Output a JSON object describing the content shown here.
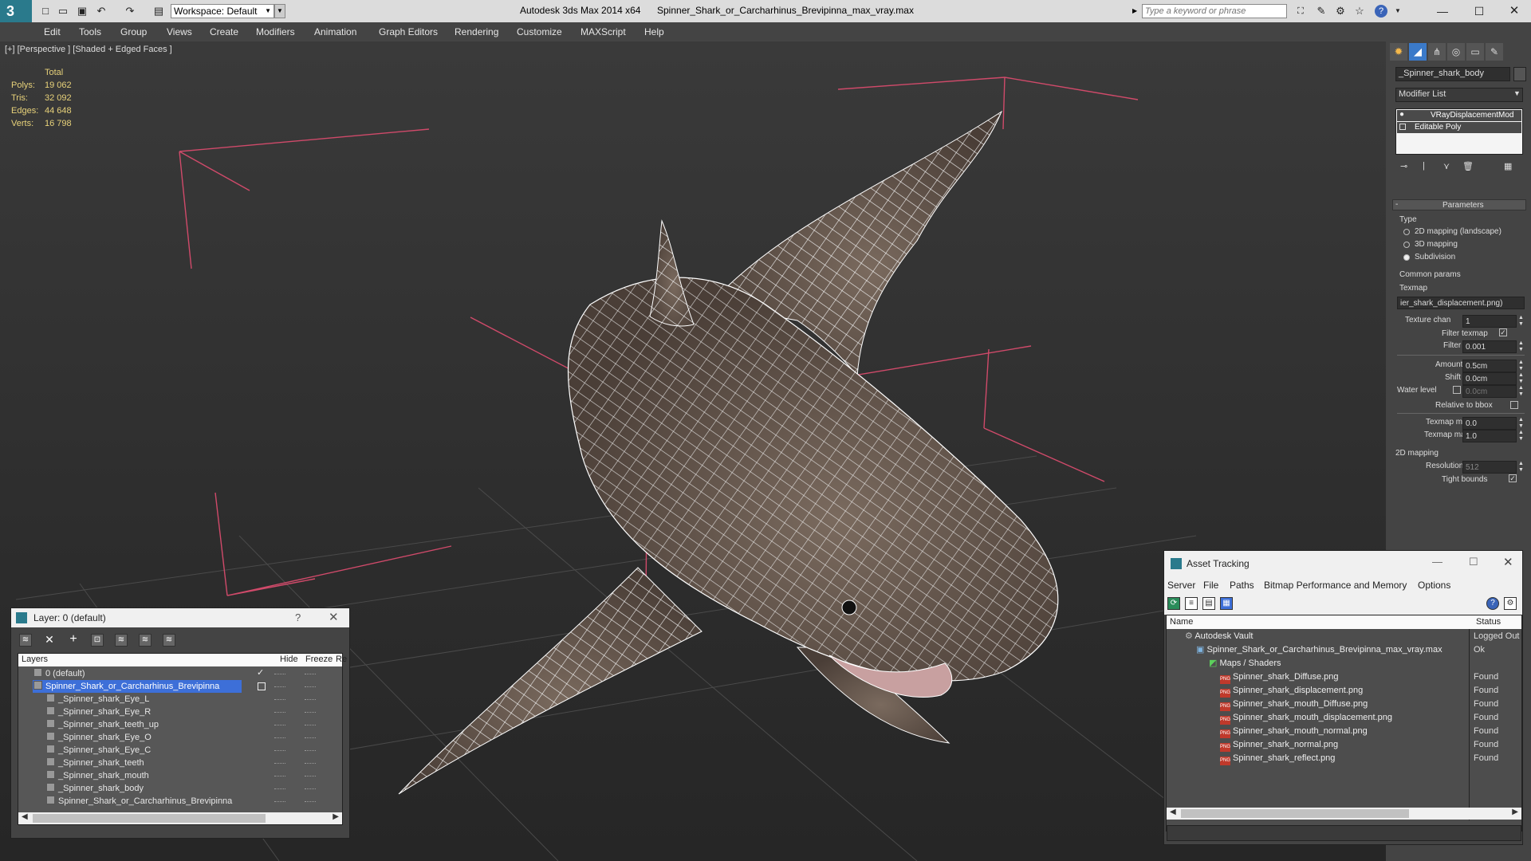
{
  "titlebar": {
    "workspace": "Workspace: Default",
    "app_title": "Autodesk 3ds Max  2014 x64",
    "file_title": "Spinner_Shark_or_Carcharhinus_Brevipinna_max_vray.max",
    "search_placeholder": "Type a keyword or phrase"
  },
  "menu": [
    "Edit",
    "Tools",
    "Group",
    "Views",
    "Create",
    "Modifiers",
    "Animation",
    "Graph Editors",
    "Rendering",
    "Customize",
    "MAXScript",
    "Help"
  ],
  "viewport": {
    "label": "[+] [Perspective ] [Shaded + Edged Faces ]",
    "stats_header": "Total",
    "stats": [
      {
        "label": "Polys:",
        "value": "19 062"
      },
      {
        "label": "Tris:",
        "value": "32 092"
      },
      {
        "label": "Edges:",
        "value": "44 648"
      },
      {
        "label": "Verts:",
        "value": "16 798"
      }
    ]
  },
  "cmd": {
    "object_name": "_Spinner_shark_body",
    "modifier_list": "Modifier List",
    "modifiers": [
      "VRayDisplacementMod",
      "Editable Poly"
    ],
    "rollout": "Parameters",
    "type_group": "Type",
    "type_options": [
      "2D mapping (landscape)",
      "3D mapping",
      "Subdivision"
    ],
    "common_group": "Common params",
    "texmap_label": "Texmap",
    "texmap_value": "ier_shark_displacement.png)",
    "texture_chan_label": "Texture chan",
    "texture_chan_value": "1",
    "filter_texmap_label": "Filter texmap",
    "filter_blur_label": "Filter blur",
    "filter_blur_value": "0.001",
    "amount_label": "Amount",
    "amount_value": "0.5cm",
    "shift_label": "Shift",
    "shift_value": "0.0cm",
    "water_label": "Water level",
    "water_value": "0.0cm",
    "relative_label": "Relative to bbox",
    "texmin_label": "Texmap min",
    "texmin_value": "0.0",
    "texmax_label": "Texmap max",
    "texmax_value": "1.0",
    "mapping2d_group": "2D mapping",
    "resolution_label": "Resolution",
    "resolution_value": "512",
    "tight_label": "Tight bounds"
  },
  "layer_window": {
    "title": "Layer: 0 (default)",
    "help": "?",
    "col_layers": "Layers",
    "col_hide": "Hide",
    "col_freeze": "Freeze",
    "col_r": "Re",
    "rows": [
      {
        "name": "0 (default)",
        "indent": 1,
        "selected": false
      },
      {
        "name": "Spinner_Shark_or_Carcharhinus_Brevipinna",
        "indent": 1,
        "selected": true
      },
      {
        "name": "_Spinner_shark_Eye_L",
        "indent": 2,
        "selected": false
      },
      {
        "name": "_Spinner_shark_Eye_R",
        "indent": 2,
        "selected": false
      },
      {
        "name": "_Spinner_shark_teeth_up",
        "indent": 2,
        "selected": false
      },
      {
        "name": "_Spinner_shark_Eye_O",
        "indent": 2,
        "selected": false
      },
      {
        "name": "_Spinner_shark_Eye_C",
        "indent": 2,
        "selected": false
      },
      {
        "name": "_Spinner_shark_teeth",
        "indent": 2,
        "selected": false
      },
      {
        "name": "_Spinner_shark_mouth",
        "indent": 2,
        "selected": false
      },
      {
        "name": "_Spinner_shark_body",
        "indent": 2,
        "selected": false
      },
      {
        "name": "Spinner_Shark_or_Carcharhinus_Brevipinna",
        "indent": 2,
        "selected": false
      }
    ]
  },
  "asset_window": {
    "title": "Asset Tracking",
    "menu": [
      "Server",
      "File",
      "Paths",
      "Bitmap Performance and Memory",
      "Options"
    ],
    "col_name": "Name",
    "col_status": "Status",
    "rows": [
      {
        "name": "Autodesk Vault",
        "status": "Logged Out",
        "level": 0,
        "type": "vault"
      },
      {
        "name": "Spinner_Shark_or_Carcharhinus_Brevipinna_max_vray.max",
        "status": "Ok",
        "level": 1,
        "type": "max"
      },
      {
        "name": "Maps / Shaders",
        "status": "",
        "level": 2,
        "type": "folder"
      },
      {
        "name": "Spinner_shark_Diffuse.png",
        "status": "Found",
        "level": 3,
        "type": "png"
      },
      {
        "name": "Spinner_shark_displacement.png",
        "status": "Found",
        "level": 3,
        "type": "png"
      },
      {
        "name": "Spinner_shark_mouth_Diffuse.png",
        "status": "Found",
        "level": 3,
        "type": "png"
      },
      {
        "name": "Spinner_shark_mouth_displacement.png",
        "status": "Found",
        "level": 3,
        "type": "png"
      },
      {
        "name": "Spinner_shark_mouth_normal.png",
        "status": "Found",
        "level": 3,
        "type": "png"
      },
      {
        "name": "Spinner_shark_normal.png",
        "status": "Found",
        "level": 3,
        "type": "png"
      },
      {
        "name": "Spinner_shark_reflect.png",
        "status": "Found",
        "level": 3,
        "type": "png"
      }
    ]
  },
  "colors": {
    "accent_selected": "#3d6fd8",
    "stats": "#e8d27a",
    "shark_fill": "#6b5c52"
  }
}
